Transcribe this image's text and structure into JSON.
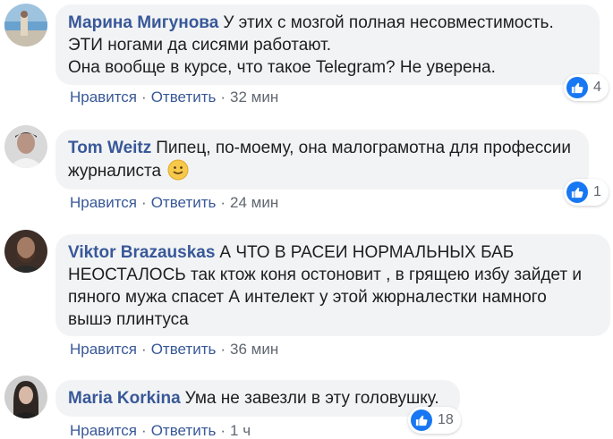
{
  "comments": [
    {
      "author": "Марина Мигунова",
      "text": "У этих с мозгой полная несовместимость.\nЭТИ ногами да сисями работают.\nОна вообще в курсе, что такое Telegram? Не уверена.",
      "like_label": "Нравится",
      "reply_label": "Ответить",
      "time": "32 мин",
      "reactions": "4",
      "avatar": "beach-photo-avatar"
    },
    {
      "author": "Tom Weitz",
      "text": "Пипец, по-моему, она малограмотна для профессии\nжурналиста",
      "emoji": "slightly-smiling-face-icon",
      "like_label": "Нравится",
      "reply_label": "Ответить",
      "time": "24 мин",
      "reactions": "1",
      "avatar": "man-portrait-avatar"
    },
    {
      "author": "Viktor Brazauskas",
      "text": "А ЧТО В РАСЕИ НОРМАЛЬНЫХ БАБ\nНЕОСТАЛОСЬ так ктож коня остоновит , в грящею избу зайдет и\nпяного мужа спасет А интелект у этой жюрналестки намного\nвышэ плинтуса",
      "like_label": "Нравится",
      "reply_label": "Ответить",
      "time": "36 мин",
      "avatar": "bearded-man-avatar"
    },
    {
      "author": "Maria Korkina",
      "text": "Ума не завезли в эту головушку.",
      "like_label": "Нравится",
      "reply_label": "Ответить",
      "time": "1 ч",
      "reactions": "18",
      "avatar": "woman-portrait-avatar"
    }
  ],
  "colors": {
    "author": "#385898",
    "bubble": "#f2f3f5",
    "meta": "#606770",
    "like": "#1877f2"
  }
}
